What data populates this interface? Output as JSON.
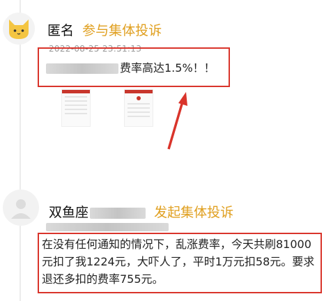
{
  "post1": {
    "author": "匿名",
    "action": "参与集体投诉",
    "timestamp": "2022-08-25 23:51:13",
    "text": "费率高达1.5%！！"
  },
  "post2": {
    "author": "双鱼座",
    "action": "发起集体投诉",
    "text": "在没有任何通知的情况下，乱涨费率，今天共刷81000元扣了我1224元，大吓人了，平时1万元扣58元。要求退还多扣的费率755元。"
  },
  "colors": {
    "accent": "#e0a021",
    "highlight": "#d9342b"
  },
  "icons": [
    "cat-avatar-icon",
    "default-avatar-icon",
    "red-arrow-icon"
  ]
}
